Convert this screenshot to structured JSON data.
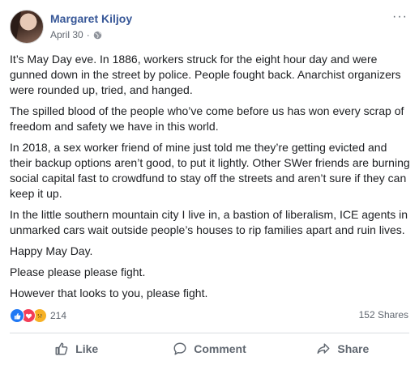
{
  "post": {
    "author": "Margaret Kiljoy",
    "date": "April 30",
    "privacy_icon": "globe-icon",
    "more_icon": "more-options-icon",
    "paragraphs": [
      "It’s May Day eve. In 1886, workers struck for the eight hour day and were gunned down in the street by police. People fought back. Anarchist organizers were rounded up, tried, and hanged.",
      "The spilled blood of the people who’ve come before us has won every scrap of freedom and safety we have in this world.",
      "In 2018, a sex worker friend of mine just told me they’re getting evicted and their backup options aren’t good, to put it lightly. Other SWer friends are burning social capital fast to crowdfund to stay off the streets and aren’t sure if they can keep it up.",
      "In the little southern mountain city I live in, a bastion of liberalism, ICE agents in unmarked cars wait outside people’s houses to rip families apart and ruin lives.",
      "Happy May Day.",
      "Please please please fight.",
      "However that looks to you, please fight."
    ],
    "reactions": {
      "icons": [
        "like-reaction-icon",
        "love-reaction-icon",
        "sad-reaction-icon"
      ],
      "count": "214"
    },
    "shares": "152 Shares",
    "actions": {
      "like": "Like",
      "comment": "Comment",
      "share": "Share"
    },
    "colors": {
      "author_link": "#385898",
      "text": "#1c1e21",
      "secondary": "#606770",
      "like_blue": "#2078f4",
      "love_red": "#f33e58",
      "sad_yellow": "#f7b125"
    }
  }
}
